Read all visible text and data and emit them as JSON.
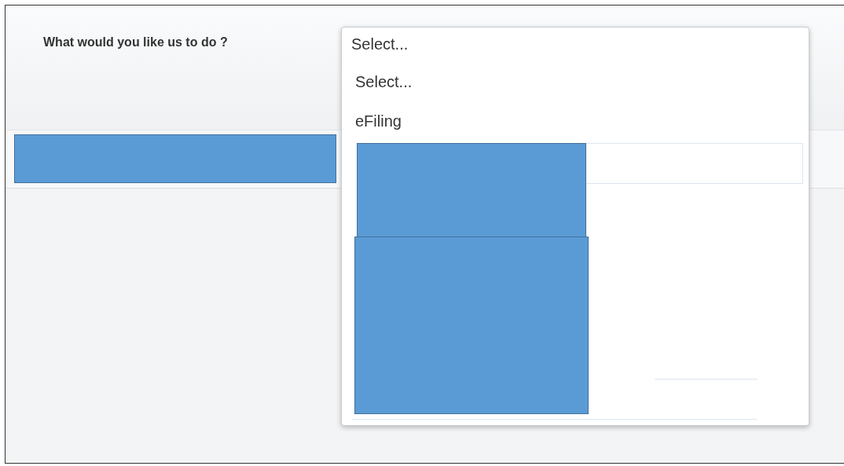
{
  "question": {
    "label": "What would you like us to do ?"
  },
  "dropdown": {
    "value": "Select...",
    "expanded": true,
    "options": [
      {
        "label": "Select..."
      },
      {
        "label": "eFiling"
      }
    ]
  }
}
